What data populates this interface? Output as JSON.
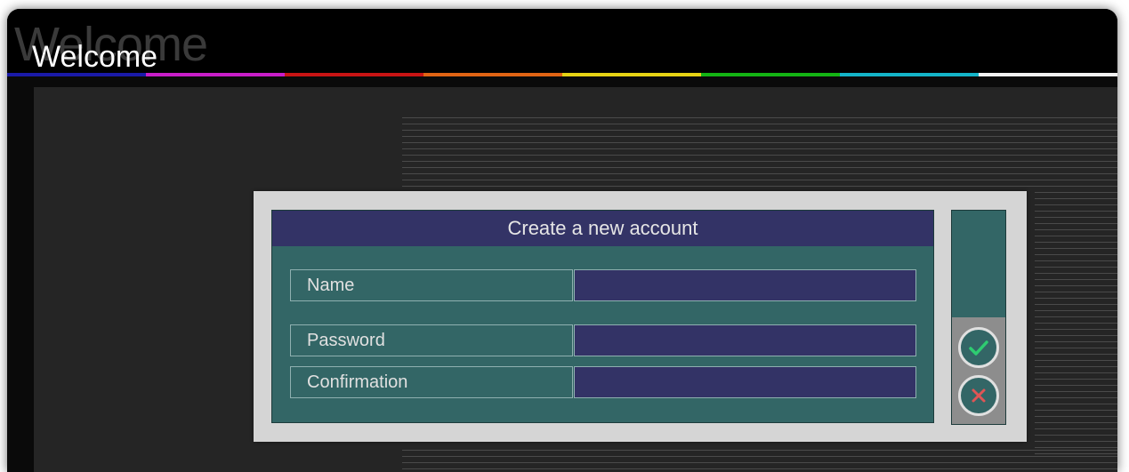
{
  "window": {
    "title": "Welcome",
    "title_ghost": "Welcome",
    "stripe_colors": [
      "#1a1aa8",
      "#c81ec8",
      "#c81414",
      "#e06414",
      "#e6d214",
      "#14b414",
      "#14b4c8",
      "#f0f0f0"
    ]
  },
  "dialog": {
    "header": "Create a new account",
    "fields": [
      {
        "label": "Name",
        "value": "",
        "placeholder": ""
      },
      {
        "label": "Password",
        "value": "",
        "placeholder": ""
      },
      {
        "label": "Confirmation",
        "value": "",
        "placeholder": ""
      }
    ],
    "confirm_icon": "checkmark-icon",
    "cancel_icon": "x-icon"
  },
  "colors": {
    "panel_teal": "#336666",
    "header_navy": "#333366",
    "confirm_green": "#2ecc71",
    "cancel_red": "#e05555"
  }
}
